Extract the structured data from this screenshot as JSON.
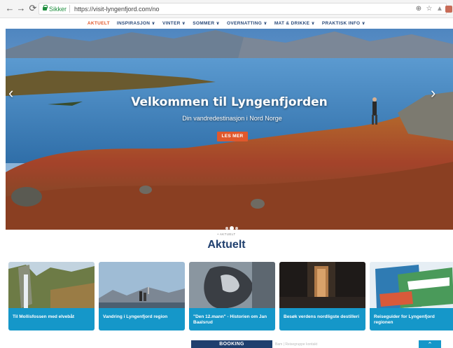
{
  "browser": {
    "secure_label": "Sikker",
    "url": "https://visit-lyngenfjord.com/no"
  },
  "nav": [
    {
      "label": "AKTUELT",
      "active": true
    },
    {
      "label": "INSPIRASJON ∨"
    },
    {
      "label": "VINTER ∨"
    },
    {
      "label": "SOMMER ∨"
    },
    {
      "label": "OVERNATTING ∨"
    },
    {
      "label": "MAT & DRIKKE ∨"
    },
    {
      "label": "PRAKTISK INFO ∨"
    }
  ],
  "hero": {
    "title": "Velkommen til Lyngenfjorden",
    "subtitle": "Din vandredestinasjon i Nord Norge",
    "button": "LES MER",
    "active_slide": 2,
    "slide_count": 3
  },
  "section": {
    "crumb": "• AKTUELT",
    "title": "Aktuelt"
  },
  "cards": [
    {
      "caption": "Til Mollisfossen med elvebåt"
    },
    {
      "caption": "Vandring i Lyngenfjord region"
    },
    {
      "caption": "\"Den 12.mann\" - Historien om Jan Baalsrud"
    },
    {
      "caption": "Besøk verdens nordligste destilleri"
    },
    {
      "caption": "Reiseguider for Lyngenfjord regionen"
    }
  ],
  "bottom": {
    "booking": "BOOKING",
    "side_text": "Bam | Reisegruppe kontakt"
  },
  "colors": {
    "accent": "#e0582c",
    "brand_blue": "#1f3f6e",
    "card_blue": "#1597c9"
  }
}
